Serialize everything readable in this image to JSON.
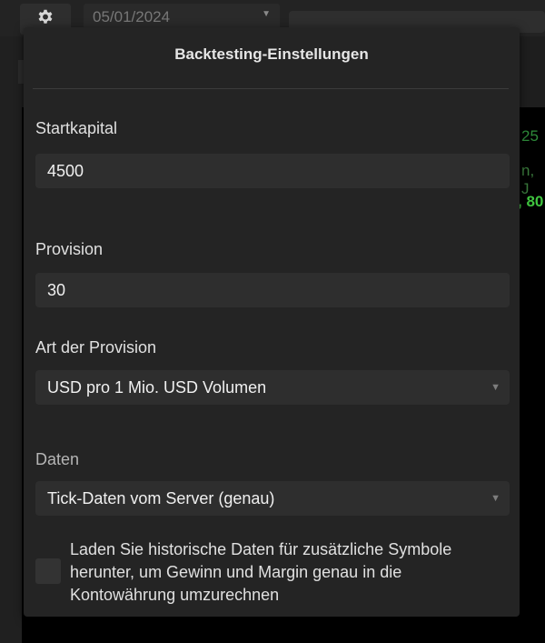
{
  "toolbar": {
    "settings_icon": "gear-icon",
    "date_value": "05/01/2024"
  },
  "background": {
    "value_1": "25",
    "value_2": "n, J",
    "value_3": ", 80"
  },
  "dialog": {
    "title": "Backtesting-Einstellungen",
    "start_capital": {
      "label": "Startkapital",
      "value": "4500"
    },
    "commission": {
      "label": "Provision",
      "value": "30"
    },
    "commission_type": {
      "label": "Art der Provision",
      "selected": "USD pro 1 Mio. USD Volumen"
    },
    "data": {
      "label": "Daten",
      "selected": "Tick-Daten vom Server (genau)"
    },
    "history_checkbox": {
      "checked": false,
      "label": "Laden Sie historische Daten für zusätzliche Symbole herunter, um Gewinn und Margin genau in die Kontowährung umzurechnen"
    }
  }
}
